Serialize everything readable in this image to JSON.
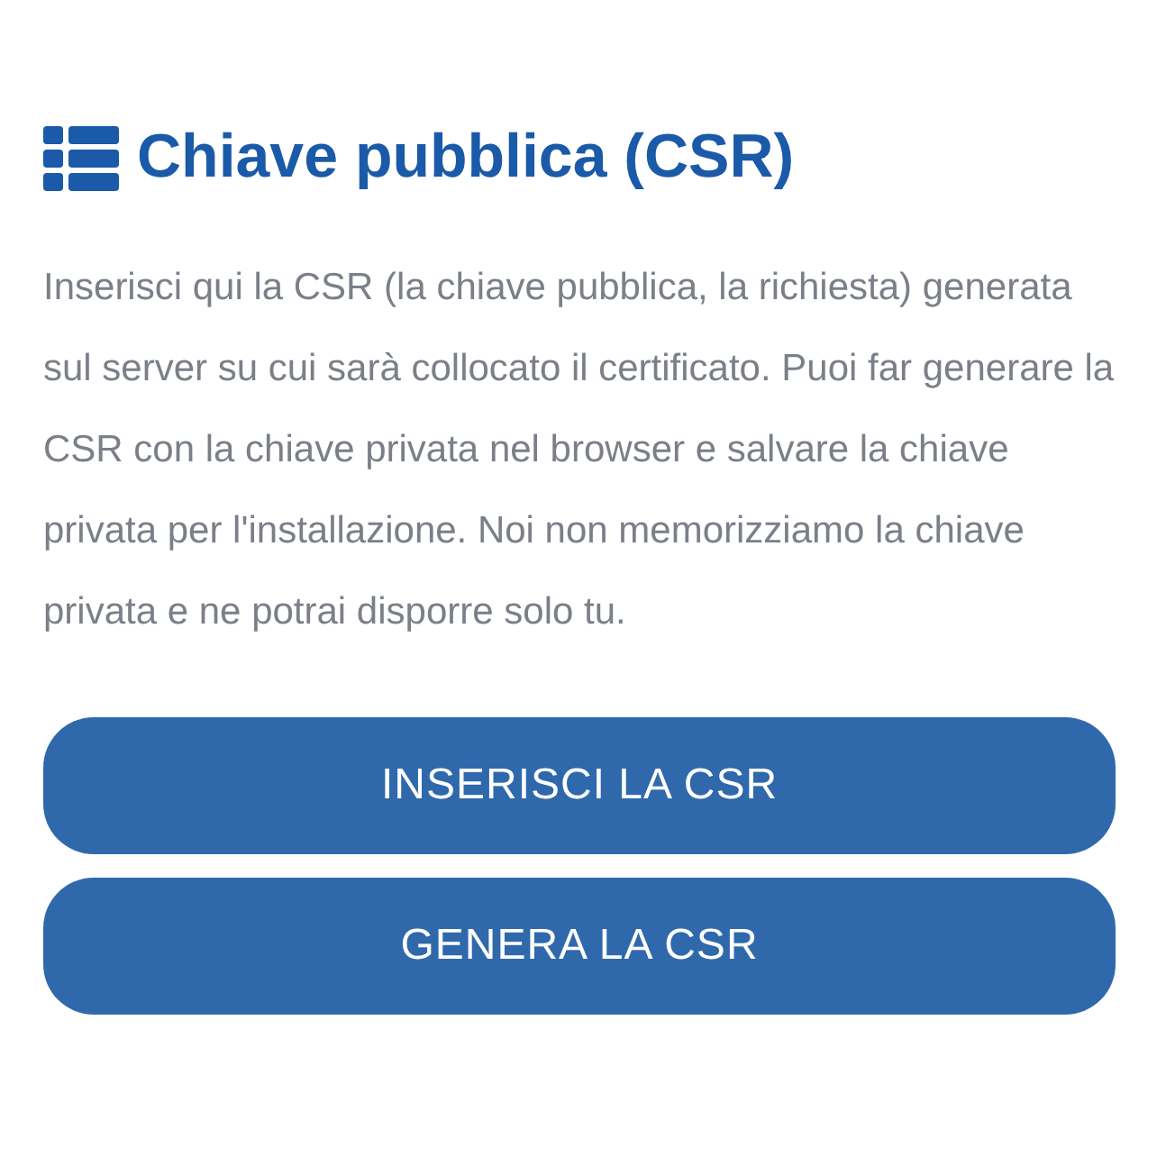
{
  "title": "Chiave pubblica (CSR)",
  "description": "Inserisci qui la CSR (la chiave pubblica, la richiesta) generata sul server su cui sarà collocato il certificato. Puoi far generare la CSR con la chiave privata nel browser e salvare la chiave privata per l'installazione. Noi non memorizziamo la chiave privata e ne potrai disporre solo tu.",
  "buttons": [
    "INSERISCI LA CSR",
    "GENERA LA CSR"
  ]
}
